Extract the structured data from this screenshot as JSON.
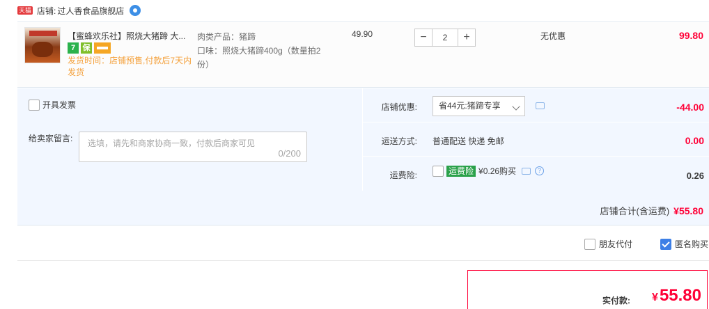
{
  "shop": {
    "badge": "天猫",
    "label": "店铺:",
    "name": "过人香食品旗舰店"
  },
  "item": {
    "title": "【蜜蜂欢乐社】照烧大猪蹄 大...",
    "ship_note": "发货时间：店铺预售,付款后7天内发货",
    "sku_line1": "肉类产品：猪蹄",
    "sku_line2": "口味：照烧大猪蹄400g（数量拍2份）",
    "unit_price": "49.90",
    "quantity": "2",
    "promo": "无优惠",
    "subtotal": "99.80",
    "icons": [
      "seven-day-return-icon",
      "guarantee-icon",
      "credit-card-icon"
    ]
  },
  "options": {
    "invoice_label": "开具发票",
    "message_label": "给卖家留言:",
    "message_placeholder": "选填，请先和商家协商一致，付款后商家可见",
    "message_count": "0/200",
    "coupon_label": "店铺优惠:",
    "coupon_value": "省44元:猪蹄专享",
    "discount": "-44.00",
    "shipping_label": "运送方式:",
    "shipping_value": "普通配送 快递 免邮",
    "shipping_fee": "0.00",
    "insurance_label": "运费险:",
    "insurance_tag": "运费险",
    "insurance_text": "¥0.26购买",
    "insurance_fee": "0.26"
  },
  "store_total": {
    "label": "店铺合计(含运费)",
    "value": "¥55.80"
  },
  "bottom": {
    "friend_pay": "朋友代付",
    "anonymous": "匿名购买",
    "pay_label": "实付款:",
    "pay_currency": "¥",
    "pay_value": "55.80"
  },
  "colors": {
    "accent": "#ff0036",
    "panel": "#f2f7ff",
    "link": "#3d7fe6"
  }
}
